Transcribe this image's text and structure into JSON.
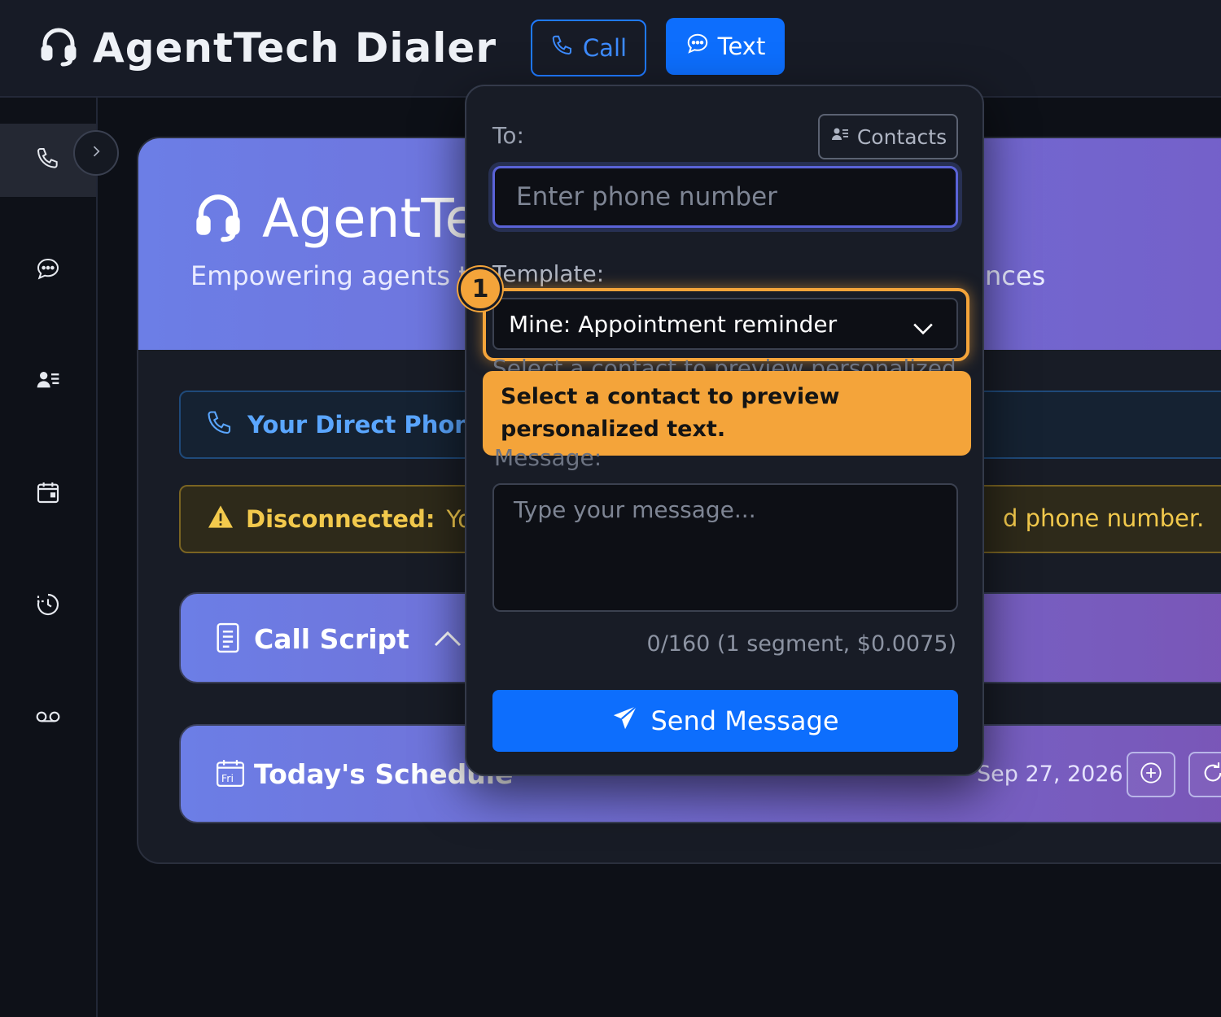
{
  "header": {
    "title": "AgentTech Dialer",
    "call_label": "Call",
    "text_label": "Text"
  },
  "sidebar": {
    "items": [
      {
        "icon": "phone-icon",
        "active": true
      },
      {
        "icon": "chat-icon"
      },
      {
        "icon": "contacts-icon"
      },
      {
        "icon": "calendar-icon"
      },
      {
        "icon": "history-icon"
      },
      {
        "icon": "voicemail-icon"
      }
    ]
  },
  "hero": {
    "title": "AgentTe",
    "subtitle": "Empowering agents t",
    "subtitle_end": "nces"
  },
  "phone_box": {
    "label": "Your Direct Phon"
  },
  "warning": {
    "strong": "Disconnected:",
    "text": "Yo",
    "text_end": "d phone number."
  },
  "call_script": {
    "title": "Call Script"
  },
  "schedule": {
    "title": "Today's Schedule",
    "day_icon_label": "Fri",
    "date": "Sep 27, 2026"
  },
  "popover": {
    "to_label": "To:",
    "contacts_label": "Contacts",
    "phone_placeholder": "Enter phone number",
    "template_label": "Template:",
    "template_selected": "Mine: Appointment reminder",
    "hint_obscured": "Select a contact to preview personalized",
    "message_label": "Message:",
    "message_placeholder": "Type your message...",
    "counter": "0/160 (1 segment, $0.0075)",
    "send_label": "Send Message"
  },
  "tour": {
    "step": "1",
    "tooltip": "Select a contact to preview personalized text."
  },
  "colors": {
    "primary": "#0d6efd",
    "highlight": "#f4a43a",
    "warning_text": "#f2c94c",
    "hero_start": "#6c7ee6",
    "hero_end": "#7460c9"
  }
}
